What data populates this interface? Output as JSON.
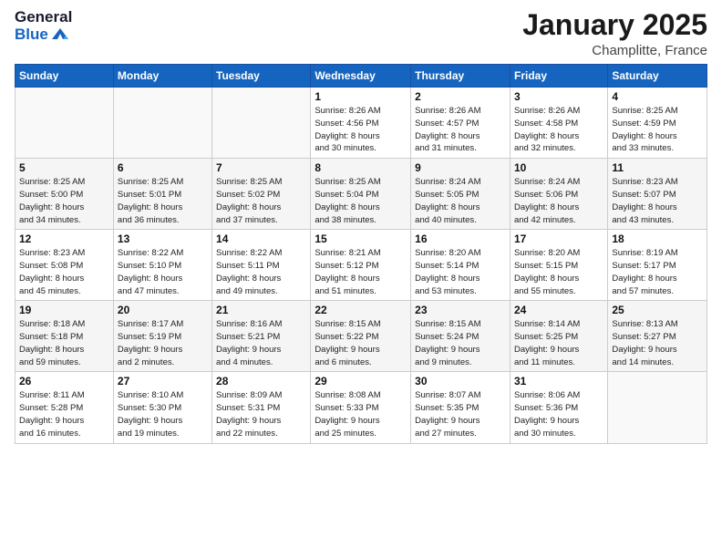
{
  "header": {
    "logo_general": "General",
    "logo_blue": "Blue",
    "month": "January 2025",
    "location": "Champlitte, France"
  },
  "days_of_week": [
    "Sunday",
    "Monday",
    "Tuesday",
    "Wednesday",
    "Thursday",
    "Friday",
    "Saturday"
  ],
  "weeks": [
    [
      {
        "day": "",
        "info": ""
      },
      {
        "day": "",
        "info": ""
      },
      {
        "day": "",
        "info": ""
      },
      {
        "day": "1",
        "info": "Sunrise: 8:26 AM\nSunset: 4:56 PM\nDaylight: 8 hours\nand 30 minutes."
      },
      {
        "day": "2",
        "info": "Sunrise: 8:26 AM\nSunset: 4:57 PM\nDaylight: 8 hours\nand 31 minutes."
      },
      {
        "day": "3",
        "info": "Sunrise: 8:26 AM\nSunset: 4:58 PM\nDaylight: 8 hours\nand 32 minutes."
      },
      {
        "day": "4",
        "info": "Sunrise: 8:25 AM\nSunset: 4:59 PM\nDaylight: 8 hours\nand 33 minutes."
      }
    ],
    [
      {
        "day": "5",
        "info": "Sunrise: 8:25 AM\nSunset: 5:00 PM\nDaylight: 8 hours\nand 34 minutes."
      },
      {
        "day": "6",
        "info": "Sunrise: 8:25 AM\nSunset: 5:01 PM\nDaylight: 8 hours\nand 36 minutes."
      },
      {
        "day": "7",
        "info": "Sunrise: 8:25 AM\nSunset: 5:02 PM\nDaylight: 8 hours\nand 37 minutes."
      },
      {
        "day": "8",
        "info": "Sunrise: 8:25 AM\nSunset: 5:04 PM\nDaylight: 8 hours\nand 38 minutes."
      },
      {
        "day": "9",
        "info": "Sunrise: 8:24 AM\nSunset: 5:05 PM\nDaylight: 8 hours\nand 40 minutes."
      },
      {
        "day": "10",
        "info": "Sunrise: 8:24 AM\nSunset: 5:06 PM\nDaylight: 8 hours\nand 42 minutes."
      },
      {
        "day": "11",
        "info": "Sunrise: 8:23 AM\nSunset: 5:07 PM\nDaylight: 8 hours\nand 43 minutes."
      }
    ],
    [
      {
        "day": "12",
        "info": "Sunrise: 8:23 AM\nSunset: 5:08 PM\nDaylight: 8 hours\nand 45 minutes."
      },
      {
        "day": "13",
        "info": "Sunrise: 8:22 AM\nSunset: 5:10 PM\nDaylight: 8 hours\nand 47 minutes."
      },
      {
        "day": "14",
        "info": "Sunrise: 8:22 AM\nSunset: 5:11 PM\nDaylight: 8 hours\nand 49 minutes."
      },
      {
        "day": "15",
        "info": "Sunrise: 8:21 AM\nSunset: 5:12 PM\nDaylight: 8 hours\nand 51 minutes."
      },
      {
        "day": "16",
        "info": "Sunrise: 8:20 AM\nSunset: 5:14 PM\nDaylight: 8 hours\nand 53 minutes."
      },
      {
        "day": "17",
        "info": "Sunrise: 8:20 AM\nSunset: 5:15 PM\nDaylight: 8 hours\nand 55 minutes."
      },
      {
        "day": "18",
        "info": "Sunrise: 8:19 AM\nSunset: 5:17 PM\nDaylight: 8 hours\nand 57 minutes."
      }
    ],
    [
      {
        "day": "19",
        "info": "Sunrise: 8:18 AM\nSunset: 5:18 PM\nDaylight: 8 hours\nand 59 minutes."
      },
      {
        "day": "20",
        "info": "Sunrise: 8:17 AM\nSunset: 5:19 PM\nDaylight: 9 hours\nand 2 minutes."
      },
      {
        "day": "21",
        "info": "Sunrise: 8:16 AM\nSunset: 5:21 PM\nDaylight: 9 hours\nand 4 minutes."
      },
      {
        "day": "22",
        "info": "Sunrise: 8:15 AM\nSunset: 5:22 PM\nDaylight: 9 hours\nand 6 minutes."
      },
      {
        "day": "23",
        "info": "Sunrise: 8:15 AM\nSunset: 5:24 PM\nDaylight: 9 hours\nand 9 minutes."
      },
      {
        "day": "24",
        "info": "Sunrise: 8:14 AM\nSunset: 5:25 PM\nDaylight: 9 hours\nand 11 minutes."
      },
      {
        "day": "25",
        "info": "Sunrise: 8:13 AM\nSunset: 5:27 PM\nDaylight: 9 hours\nand 14 minutes."
      }
    ],
    [
      {
        "day": "26",
        "info": "Sunrise: 8:11 AM\nSunset: 5:28 PM\nDaylight: 9 hours\nand 16 minutes."
      },
      {
        "day": "27",
        "info": "Sunrise: 8:10 AM\nSunset: 5:30 PM\nDaylight: 9 hours\nand 19 minutes."
      },
      {
        "day": "28",
        "info": "Sunrise: 8:09 AM\nSunset: 5:31 PM\nDaylight: 9 hours\nand 22 minutes."
      },
      {
        "day": "29",
        "info": "Sunrise: 8:08 AM\nSunset: 5:33 PM\nDaylight: 9 hours\nand 25 minutes."
      },
      {
        "day": "30",
        "info": "Sunrise: 8:07 AM\nSunset: 5:35 PM\nDaylight: 9 hours\nand 27 minutes."
      },
      {
        "day": "31",
        "info": "Sunrise: 8:06 AM\nSunset: 5:36 PM\nDaylight: 9 hours\nand 30 minutes."
      },
      {
        "day": "",
        "info": ""
      }
    ]
  ]
}
